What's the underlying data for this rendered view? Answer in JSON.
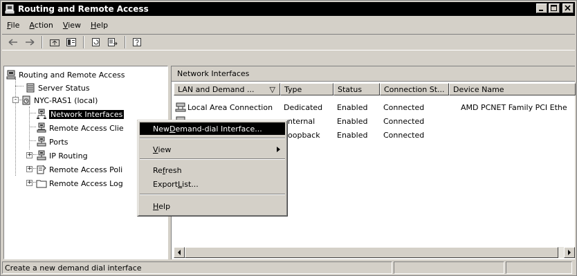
{
  "window": {
    "title": "Routing and Remote Access"
  },
  "menubar": {
    "items": [
      {
        "label": "File",
        "mnemonic": "F",
        "rest": "ile"
      },
      {
        "label": "Action",
        "mnemonic": "A",
        "rest": "ction"
      },
      {
        "label": "View",
        "mnemonic": "V",
        "rest": "iew"
      },
      {
        "label": "Help",
        "mnemonic": "H",
        "rest": "elp"
      }
    ]
  },
  "toolbar": {
    "buttons": [
      "back-icon",
      "forward-icon",
      "up-folder-icon",
      "show-hide-tree-icon",
      "refresh-icon",
      "export-list-icon",
      "help-icon"
    ]
  },
  "tree": {
    "items": [
      {
        "label": "Routing and Remote Access",
        "icon": "server-icon"
      },
      {
        "label": "Server Status",
        "icon": "server-status-icon"
      },
      {
        "label": "NYC-RAS1 (local)",
        "icon": "server-local-icon",
        "expander": "-"
      },
      {
        "label": "Network Interfaces",
        "icon": "network-interfaces-icon",
        "selected": true
      },
      {
        "label": "Remote Access Clie",
        "icon": "remote-clients-icon"
      },
      {
        "label": "Ports",
        "icon": "ports-icon"
      },
      {
        "label": "IP Routing",
        "icon": "ip-routing-icon",
        "expander": "+"
      },
      {
        "label": "Remote Access Poli",
        "icon": "policy-icon",
        "expander": "+"
      },
      {
        "label": "Remote Access Log",
        "icon": "folder-icon",
        "expander": "+"
      }
    ]
  },
  "detail": {
    "pane_title": "Network Interfaces",
    "columns": [
      "LAN and Demand ...",
      "Type",
      "Status",
      "Connection St...",
      "Device Name"
    ],
    "sort_indicator": "▽",
    "rows": [
      {
        "name": "Local Area Connection",
        "type": "Dedicated",
        "status": "Enabled",
        "connection": "Connected",
        "device": "AMD PCNET Family PCI Ethe"
      },
      {
        "name": "",
        "type": "nternal",
        "status": "Enabled",
        "connection": "Connected",
        "device": ""
      },
      {
        "name": "",
        "type": "oopback",
        "status": "Enabled",
        "connection": "Connected",
        "device": ""
      }
    ]
  },
  "context_menu": {
    "items": [
      {
        "pre": "New ",
        "mnemonic": "D",
        "post": "emand-dial Interface...",
        "highlighted": true
      },
      {
        "pre": "",
        "mnemonic": "V",
        "post": "iew",
        "submenu": true
      },
      {
        "pre": "Re",
        "mnemonic": "f",
        "post": "resh"
      },
      {
        "pre": "Export ",
        "mnemonic": "L",
        "post": "ist..."
      },
      {
        "pre": "",
        "mnemonic": "H",
        "post": "elp"
      }
    ]
  },
  "statusbar": {
    "text": "Create a new demand dial interface"
  }
}
